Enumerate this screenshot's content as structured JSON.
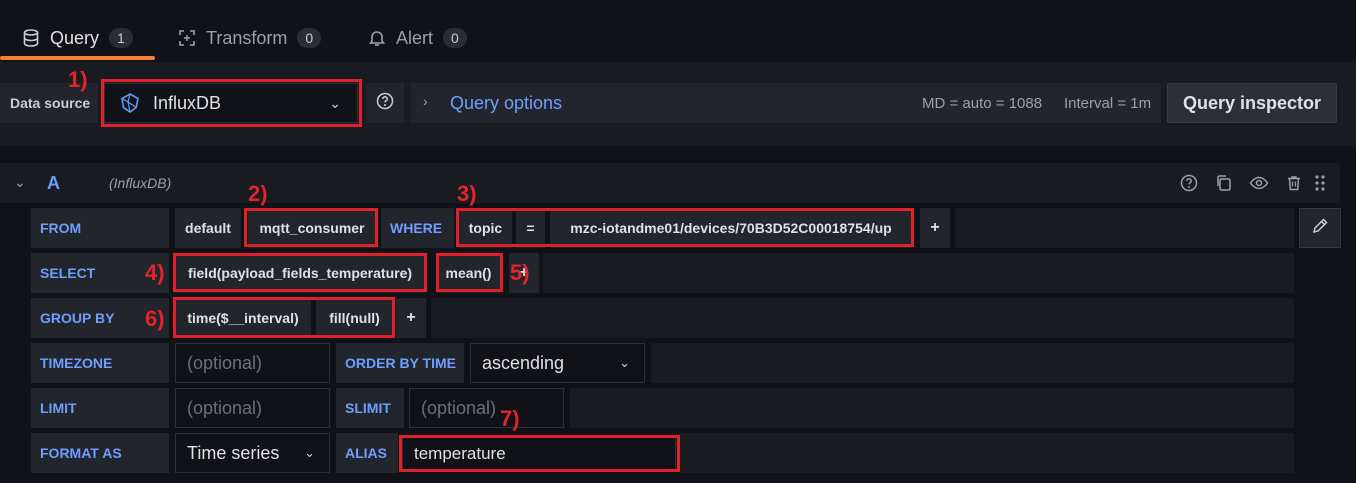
{
  "tabs": [
    {
      "label": "Query",
      "count": "1"
    },
    {
      "label": "Transform",
      "count": "0"
    },
    {
      "label": "Alert",
      "count": "0"
    }
  ],
  "toolbar": {
    "data_source_label": "Data source",
    "data_source_value": "InfluxDB",
    "query_options_label": "Query options",
    "md_text": "MD = auto = 1088",
    "interval_text": "Interval = 1m",
    "query_inspector_label": "Query inspector"
  },
  "query": {
    "letter": "A",
    "datasource": "(InfluxDB)",
    "from_label": "FROM",
    "from_policy": "default",
    "from_measurement": "mqtt_consumer",
    "where_label": "WHERE",
    "where_key": "topic",
    "where_op": "=",
    "where_value": "mzc-iotandme01/devices/70B3D52C00018754/up",
    "select_label": "SELECT",
    "select_field": "field(payload_fields_temperature)",
    "select_func": "mean()",
    "groupby_label": "GROUP BY",
    "groupby_time": "time($__interval)",
    "groupby_fill": "fill(null)",
    "timezone_label": "TIMEZONE",
    "timezone_placeholder": "(optional)",
    "orderby_label": "ORDER BY TIME",
    "orderby_value": "ascending",
    "limit_label": "LIMIT",
    "limit_placeholder": "(optional)",
    "slimit_label": "SLIMIT",
    "slimit_placeholder": "(optional)",
    "format_label": "FORMAT AS",
    "format_value": "Time series",
    "alias_label": "ALIAS",
    "alias_value": "temperature",
    "plus": "+"
  },
  "annotations": [
    "1)",
    "2)",
    "3)",
    "4)",
    "5)",
    "6)",
    "7)"
  ],
  "colors": {
    "accent": "#6e9fff",
    "annotation": "#e0202a",
    "tab_active": "#f67d38"
  }
}
